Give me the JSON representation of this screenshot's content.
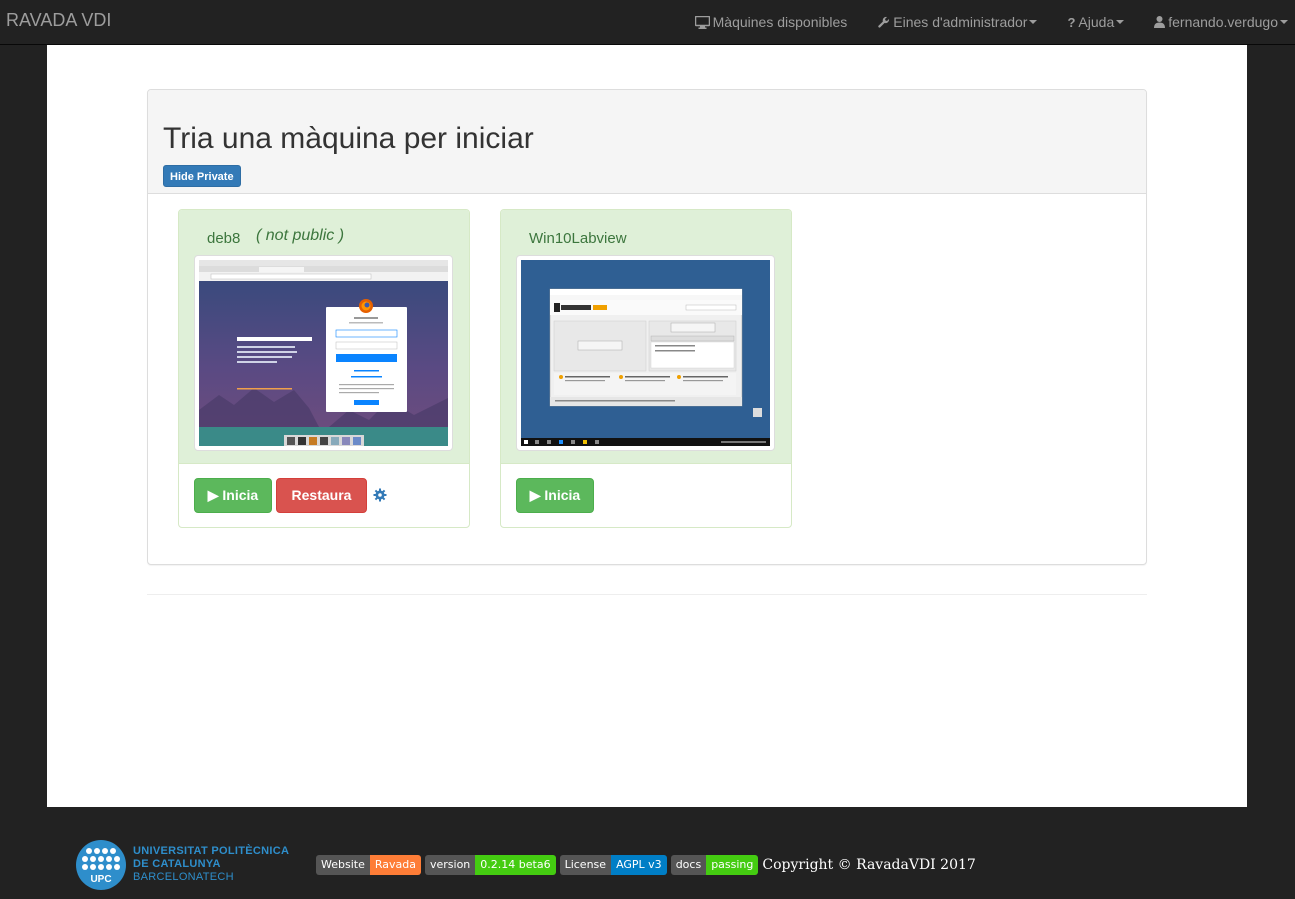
{
  "navbar": {
    "brand": "RAVADA VDI",
    "items": [
      {
        "label": "Màquines disponibles",
        "icon": "monitor-icon",
        "caret": false
      },
      {
        "label": "Eines d'administrador",
        "icon": "wrench-icon",
        "caret": true
      },
      {
        "label": "Ajuda",
        "icon": "question-icon",
        "caret": true
      },
      {
        "label": "fernando.verdugo",
        "icon": "user-icon",
        "caret": true
      }
    ]
  },
  "panel": {
    "title": "Tria una màquina per iniciar",
    "hide_private_label": "Hide Private"
  },
  "machines": [
    {
      "name": "deb8",
      "note": "( not public )",
      "start_label": "▶ Inicia",
      "restore_label": "Restaura",
      "settings_icon": "gear-icon"
    },
    {
      "name": "Win10Labview",
      "start_label": "▶ Inicia"
    }
  ],
  "footer": {
    "logo_text": [
      "UNIVERSITAT POLITÈCNICA",
      "DE CATALUNYA",
      "BARCELONATECH"
    ],
    "badges": [
      {
        "left": "Website",
        "right": "Ravada",
        "color": "#fe7d37"
      },
      {
        "left": "version",
        "right": "0.2.14 beta6",
        "color": "#4c1"
      },
      {
        "left": "License",
        "right": "AGPL v3",
        "color": "#007ec6"
      },
      {
        "left": "docs",
        "right": "passing",
        "color": "#4c1"
      }
    ],
    "copyright": "Copyright © RavadaVDI 2017"
  },
  "colors": {
    "navbar_bg": "#222222",
    "success": "#5cb85c",
    "danger": "#d9534f",
    "primary": "#337ab7"
  }
}
